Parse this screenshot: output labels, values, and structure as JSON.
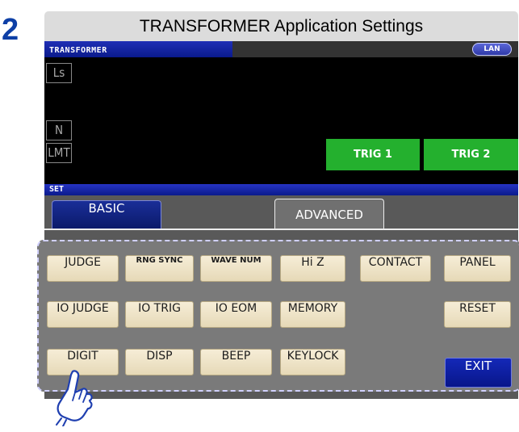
{
  "step": "2",
  "title": "TRANSFORMER Application Settings",
  "topbar": {
    "mode_label": "TRANSFORMER",
    "lan_label": "LAN"
  },
  "params": [
    "Ls",
    "N",
    "LMT"
  ],
  "trig_buttons": [
    "TRIG 1",
    "TRIG 2"
  ],
  "set_label": "SET",
  "tabs": {
    "basic": "BASIC",
    "advanced": "ADVANCED"
  },
  "buttons": {
    "judge": "JUDGE",
    "rng_sync": "RNG SYNC",
    "wave_num": "WAVE NUM",
    "hi_z": "Hi Z",
    "contact": "CONTACT",
    "panel": "PANEL",
    "io_judge": "IO JUDGE",
    "io_trig": "IO TRIG",
    "io_eom": "IO EOM",
    "memory": "MEMORY",
    "reset": "RESET",
    "digit": "DIGIT",
    "disp": "DISP",
    "beep": "BEEP",
    "keylock": "KEYLOCK",
    "exit": "EXIT"
  },
  "colors": {
    "accent_blue": "#0d3fa6",
    "trig_green": "#24b02e",
    "button_beige": "#efe3c6"
  }
}
